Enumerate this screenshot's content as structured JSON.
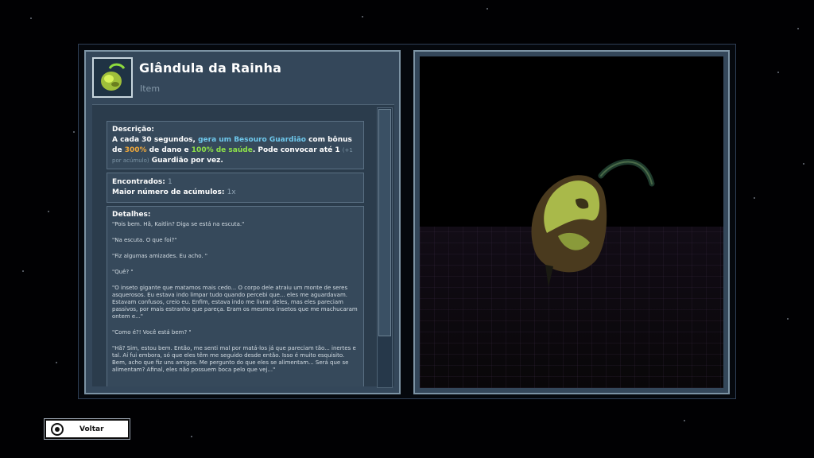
{
  "item": {
    "title": "Glândula da Rainha",
    "subtitle": "Item"
  },
  "description": {
    "label": "Descrição:",
    "part1": "A cada 30 segundos, ",
    "hl_spawn": "gera um Besouro Guardião",
    "part2": " com bônus de ",
    "hl_damage": "300%",
    "part3": " de dano e ",
    "hl_health": "100% de saúde",
    "part4": ". Pode convocar até 1 ",
    "stack_note": "(+1 por acúmulo)",
    "part5": " Guardião por vez."
  },
  "stats": {
    "found_label": "Encontrados:",
    "found_value": "1",
    "max_stack_label": "Maior número de acúmulos:",
    "max_stack_value": "1x"
  },
  "details": {
    "label": "Detalhes:",
    "paragraphs": [
      "\"Pois bem. Hã, Kaitlin? Diga se está na escuta.\"",
      "\"Na escuta. O que foi?\"",
      "\"Fiz algumas amizades. Eu acho. \"",
      "\"Quê? \"",
      "\"O inseto gigante que matamos mais cedo... O corpo dele atraiu um monte de seres asquerosos. Eu estava indo limpar tudo quando percebi que... eles me aguardavam. Estavam confusos, creio eu. Enfim, estava indo me livrar deles, mas eles pareciam passivos, por mais estranho que pareça. Eram os mesmos insetos que me machucaram ontem e...\"",
      "\"Como é?! Você está bem? \"",
      "\"Hã? Sim, estou bem. Então, me senti mal por matá-los já que pareciam tão... inertes e tal. Aí fui embora, só que eles têm me seguido desde então. Isso é muito esquisito. Bem, acho que fiz uns amigos. Me pergunto do que eles se alimentam... Será que se alimentam? Afinal, eles não possuem boca pelo que vej...\""
    ]
  },
  "back_button": {
    "label": "Voltar"
  },
  "colors": {
    "panel": "#34475a",
    "highlight_blue": "#6ec8ec",
    "highlight_gold": "#f0a83a",
    "highlight_green": "#8ee24a"
  }
}
